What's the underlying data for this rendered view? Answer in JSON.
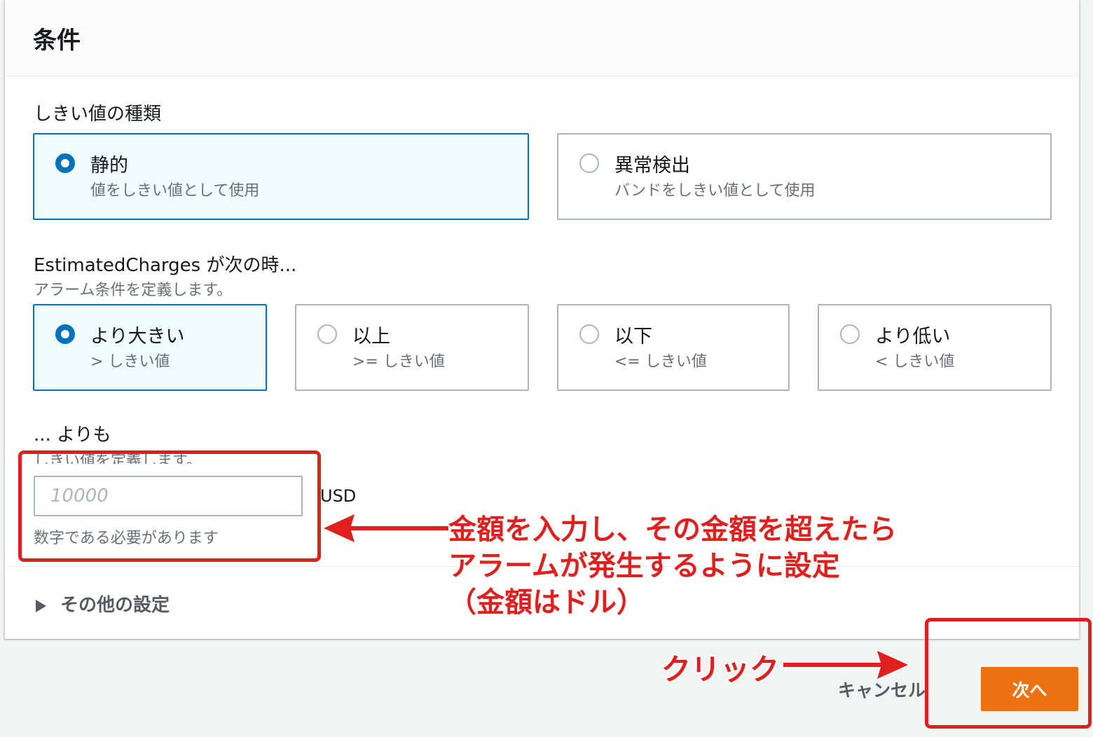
{
  "panel": {
    "title": "条件"
  },
  "threshold_type": {
    "label": "しきい値の種類",
    "options": [
      {
        "label": "静的",
        "desc": "値をしきい値として使用",
        "selected": true
      },
      {
        "label": "異常検出",
        "desc": "バンドをしきい値として使用",
        "selected": false
      }
    ]
  },
  "condition": {
    "label": "EstimatedCharges が次の時...",
    "desc": "アラーム条件を定義します。",
    "options": [
      {
        "label": "より大きい",
        "desc": "> しきい値",
        "selected": true
      },
      {
        "label": "以上",
        "desc": ">= しきい値",
        "selected": false
      },
      {
        "label": "以下",
        "desc": "<= しきい値",
        "selected": false
      },
      {
        "label": "より低い",
        "desc": "< しきい値",
        "selected": false
      }
    ]
  },
  "than": {
    "label": "... よりも",
    "desc": "しきい値を定義します。",
    "input_value": "",
    "input_placeholder": "10000",
    "unit": "USD",
    "hint": "数字である必要があります"
  },
  "additional": {
    "label": "その他の設定"
  },
  "footer": {
    "cancel_label": "キャンセル",
    "next_label": "次へ"
  },
  "annotations": {
    "amount_note_lines": [
      "金額を入力し、その金額を超えたら",
      "アラームが発生するように設定",
      "（金額はドル）"
    ],
    "click_note": "クリック",
    "color": "#e0201e"
  },
  "colors": {
    "accent": "#0073bb",
    "primary_button": "#ec7211",
    "selected_tile_bg": "#f1faff"
  }
}
